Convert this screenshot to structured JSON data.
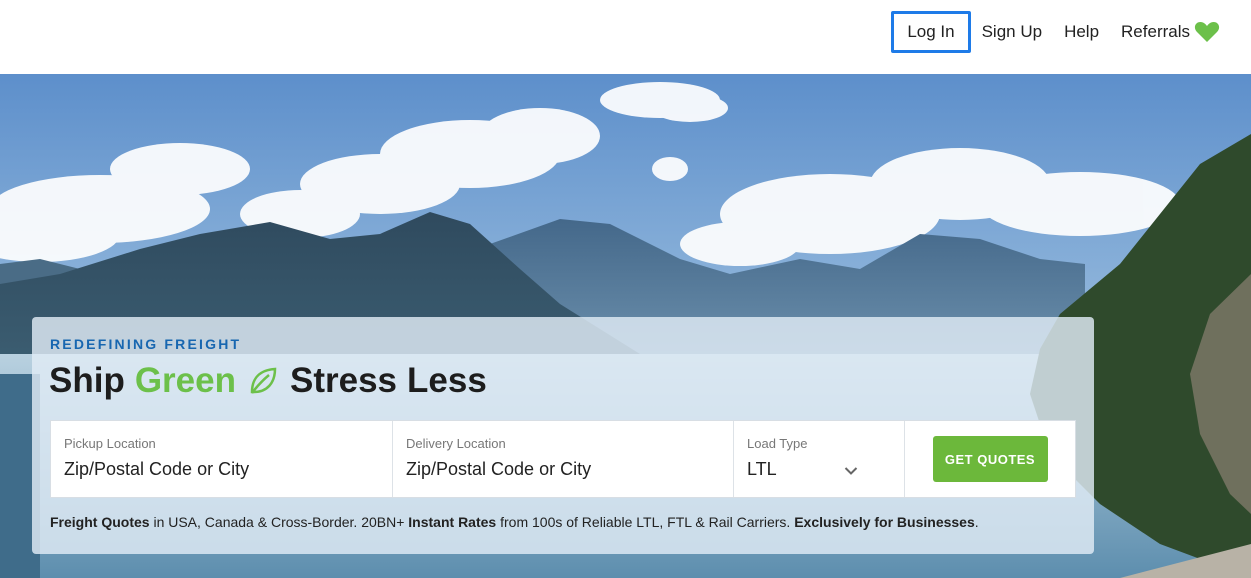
{
  "nav": {
    "login": "Log In",
    "signup": "Sign Up",
    "help": "Help",
    "referrals": "Referrals",
    "referrals_icon": "heart-icon",
    "accent": "#1e7be8"
  },
  "hero": {
    "eyebrow": "REDEFINING FREIGHT",
    "headline": {
      "part1": "Ship",
      "green_word": "Green",
      "leaf_icon": "leaf-icon",
      "part2": "Stress",
      "bold_word": "Less"
    },
    "form": {
      "pickup": {
        "label": "Pickup Location",
        "value": "Zip/Postal Code or City"
      },
      "delivery": {
        "label": "Delivery Location",
        "value": "Zip/Postal Code or City"
      },
      "load_type": {
        "label": "Load Type",
        "value": "LTL",
        "icon": "chevron-down-icon"
      },
      "submit": "GET QUOTES"
    },
    "tagline": {
      "b1": "Freight Quotes",
      "t1": " in USA, Canada & Cross-Border. 20BN+ ",
      "b2": "Instant Rates",
      "t2": " from 100s of Reliable LTL, FTL & Rail Carriers. ",
      "b3": "Exclusively for Businesses",
      "t3": "."
    },
    "colors": {
      "green": "#6cc04a",
      "blue": "#1766b0",
      "button": "#6cb83b"
    }
  }
}
